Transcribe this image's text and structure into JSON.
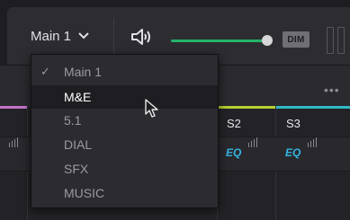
{
  "toolbar": {
    "bus_select_label": "Main 1",
    "dim_label": "DIM",
    "volume_level": 0.85
  },
  "channels": [
    {
      "name": "S2",
      "eq_label": "EQ",
      "strip_color": "#b7cf33"
    },
    {
      "name": "S3",
      "eq_label": "EQ",
      "strip_color": "#2fb9c4"
    }
  ],
  "left_strip_color": "#c474c8",
  "dropdown": {
    "items": [
      {
        "label": "Main 1",
        "checked": true,
        "hovered": false
      },
      {
        "label": "M&E",
        "checked": false,
        "hovered": true
      },
      {
        "label": "5.1",
        "checked": false,
        "hovered": false
      },
      {
        "label": "DIAL",
        "checked": false,
        "hovered": false
      },
      {
        "label": "SFX",
        "checked": false,
        "hovered": false
      },
      {
        "label": "MUSIC",
        "checked": false,
        "hovered": false
      }
    ]
  },
  "icons": [
    "chevron-down-icon",
    "speaker-icon",
    "more-icon",
    "mouse-cursor-icon",
    "check-icon"
  ],
  "colors": {
    "accent": "#24b36a",
    "eq": "#36b4e0"
  }
}
